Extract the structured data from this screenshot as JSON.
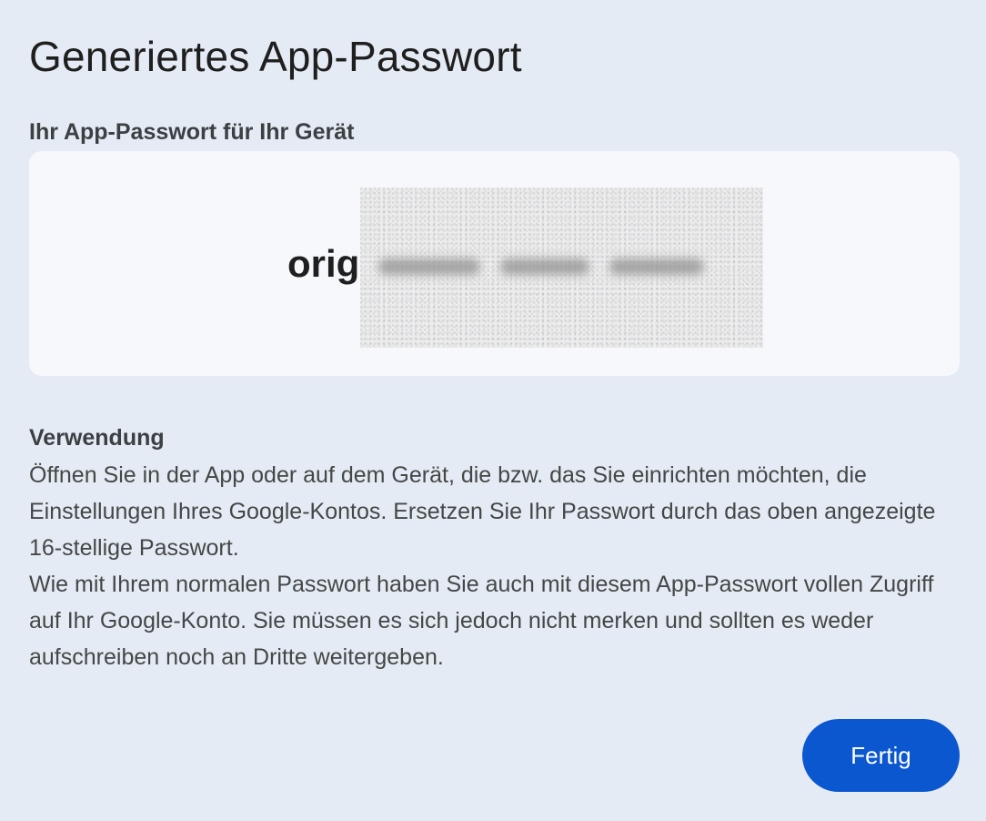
{
  "dialog": {
    "title": "Generiertes App-Passwort",
    "password_label": "Ihr App-Passwort für Ihr Gerät",
    "password_visible": "orig",
    "usage_heading": "Verwendung",
    "usage_paragraph_1": "Öffnen Sie in der App oder auf dem Gerät, die bzw. das Sie einrichten möchten, die Einstellungen Ihres Google-Kontos. Ersetzen Sie Ihr Passwort durch das oben angezeigte 16-stellige Passwort.",
    "usage_paragraph_2": "Wie mit Ihrem normalen Passwort haben Sie auch mit diesem App-Passwort vollen Zugriff auf Ihr Google-Konto. Sie müssen es sich jedoch nicht merken und sollten es weder aufschreiben noch an Dritte weitergeben.",
    "done_label": "Fertig"
  },
  "colors": {
    "background": "#e5ebf4",
    "password_box": "#f6f8fc",
    "primary_button": "#0b57d0"
  }
}
